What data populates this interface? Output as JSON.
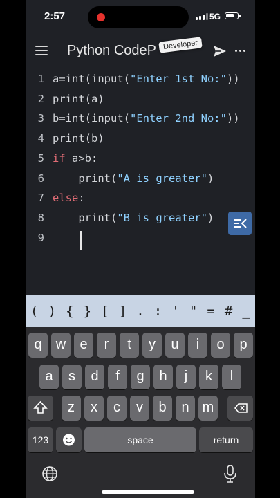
{
  "status_bar": {
    "time": "2:57",
    "network": "5G"
  },
  "app_bar": {
    "title": "Python CodeP",
    "badge": "Developer"
  },
  "editor": {
    "lines": [
      {
        "num": "1",
        "parts": [
          {
            "t": "a=int(input(",
            "c": ""
          },
          {
            "t": "\"Enter 1st No:\"",
            "c": "str"
          },
          {
            "t": "))",
            "c": ""
          }
        ]
      },
      {
        "num": "2",
        "parts": [
          {
            "t": "print(a)",
            "c": ""
          }
        ]
      },
      {
        "num": "3",
        "parts": [
          {
            "t": "b=int(input(",
            "c": ""
          },
          {
            "t": "\"Enter 2nd No:\"",
            "c": "str"
          },
          {
            "t": "))",
            "c": ""
          }
        ]
      },
      {
        "num": "4",
        "parts": [
          {
            "t": "print(b)",
            "c": ""
          }
        ]
      },
      {
        "num": "5",
        "parts": [
          {
            "t": "if",
            "c": "kw"
          },
          {
            "t": " a>b:",
            "c": ""
          }
        ]
      },
      {
        "num": "6",
        "parts": [
          {
            "t": "    print(",
            "c": ""
          },
          {
            "t": "\"A is greater\"",
            "c": "str"
          },
          {
            "t": ")",
            "c": ""
          }
        ]
      },
      {
        "num": "7",
        "parts": [
          {
            "t": "else",
            "c": "kw"
          },
          {
            "t": ":",
            "c": ""
          }
        ]
      },
      {
        "num": "8",
        "parts": [
          {
            "t": "    print(",
            "c": ""
          },
          {
            "t": "\"B is greater\"",
            "c": "str"
          },
          {
            "t": ")",
            "c": ""
          }
        ]
      },
      {
        "num": "9",
        "parts": [
          {
            "t": "",
            "c": ""
          }
        ]
      }
    ]
  },
  "symbol_bar": [
    "(",
    ")",
    "{",
    "}",
    "[",
    "]",
    ".",
    ":",
    "'",
    "\"",
    "=",
    "#",
    "_"
  ],
  "keyboard": {
    "row1": [
      "q",
      "w",
      "e",
      "r",
      "t",
      "y",
      "u",
      "i",
      "o",
      "p"
    ],
    "row2": [
      "a",
      "s",
      "d",
      "f",
      "g",
      "h",
      "j",
      "k",
      "l"
    ],
    "row3": [
      "z",
      "x",
      "c",
      "v",
      "b",
      "n",
      "m"
    ],
    "numbers_label": "123",
    "space_label": "space",
    "return_label": "return"
  },
  "colors": {
    "editor_bg": "#1f2126",
    "keyword": "#e06c75",
    "string": "#8fd1ff",
    "symbol_bar": "#c8d4e4",
    "accent_button": "#3e6aa6"
  }
}
